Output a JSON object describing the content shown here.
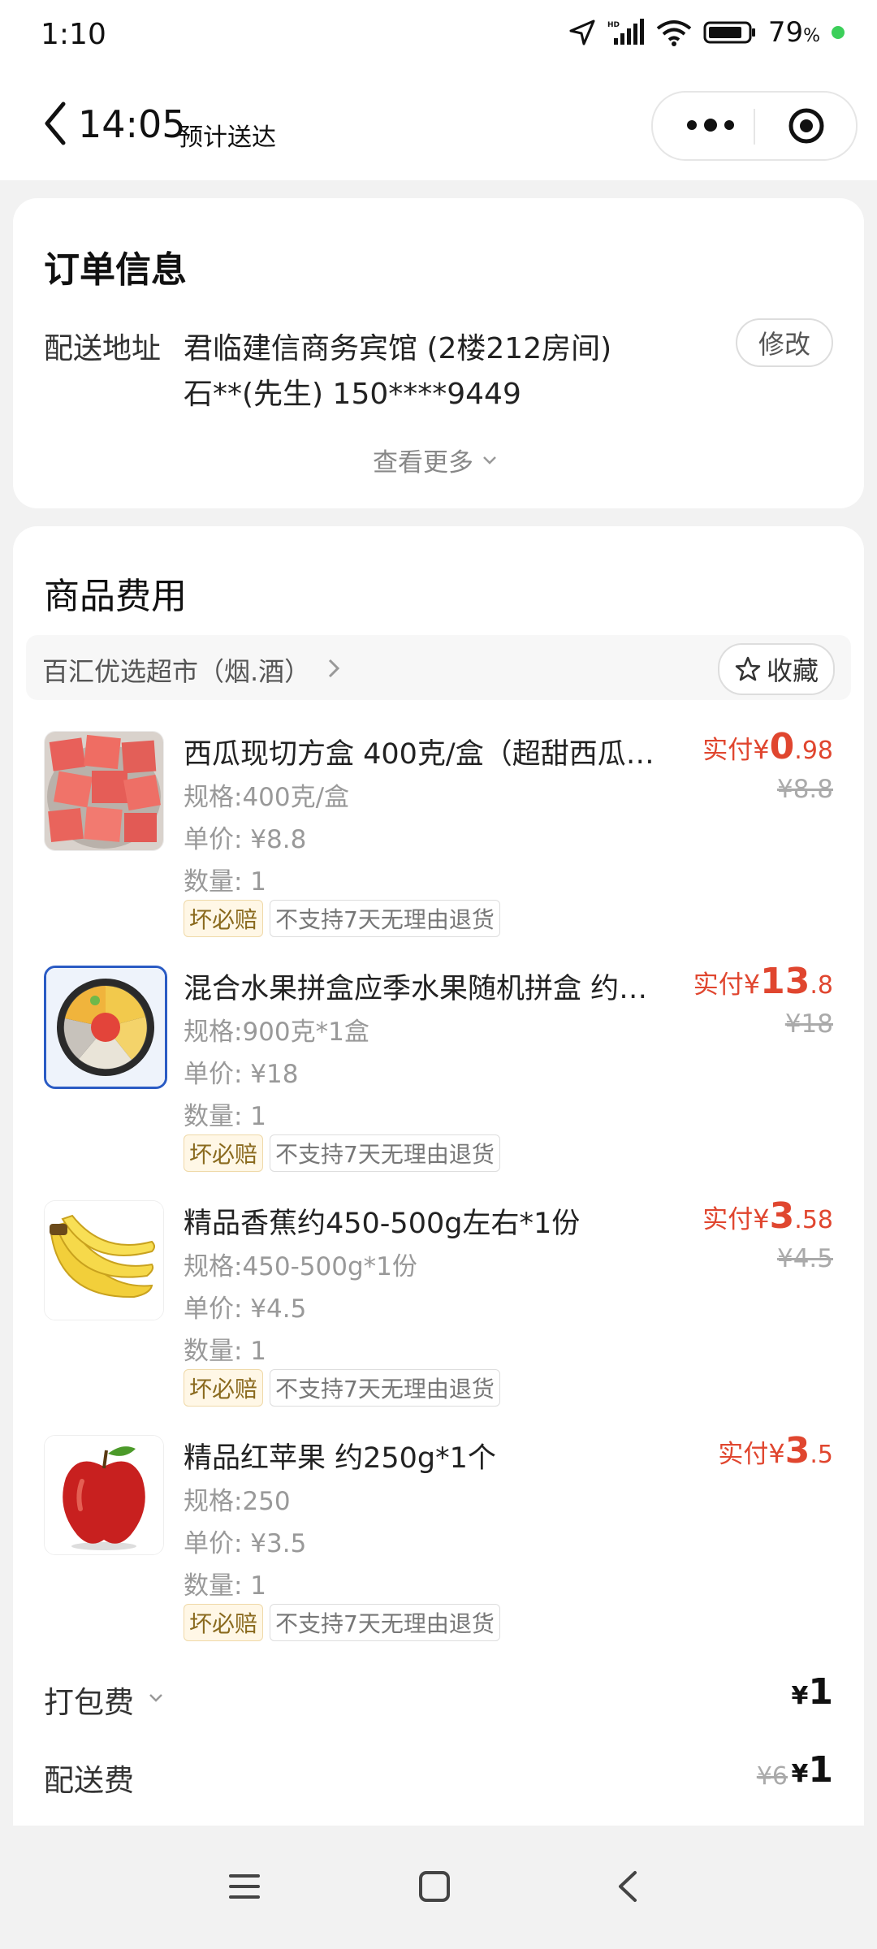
{
  "status": {
    "time": "1:10",
    "battery": "79",
    "battery_unit": "%"
  },
  "nav": {
    "time": "14:05",
    "subtitle": "预计送达"
  },
  "order": {
    "title": "订单信息",
    "address_label": "配送地址",
    "address_line1": "君临建信商务宾馆 (2楼212房间)",
    "address_line2": "石**(先生) 150****9449",
    "edit": "修改",
    "more": "查看更多"
  },
  "goods": {
    "title": "商品费用",
    "shop_name": "百汇优选超市（烟.酒）",
    "favorite": "收藏",
    "items": [
      {
        "name": "西瓜现切方盒 400克/盒（超甜西瓜…",
        "spec": "规格:400克/盒",
        "unit": "单价: ¥8.8",
        "qty": "数量: 1",
        "price_label": "实付",
        "yen": "¥",
        "price_int": "0",
        "price_dec": ".98",
        "orig": "¥8.8"
      },
      {
        "name": "混合水果拼盒应季水果随机拼盒 约…",
        "spec": "规格:900克*1盒",
        "unit": "单价: ¥18",
        "qty": "数量: 1",
        "price_label": "实付",
        "yen": "¥",
        "price_int": "13",
        "price_dec": ".8",
        "orig": "¥18"
      },
      {
        "name": "精品香蕉约450-500g左右*1份",
        "spec": "规格:450-500g*1份",
        "unit": "单价: ¥4.5",
        "qty": "数量: 1",
        "price_label": "实付",
        "yen": "¥",
        "price_int": "3",
        "price_dec": ".58",
        "orig": "¥4.5"
      },
      {
        "name": "精品红苹果 约250g*1个",
        "spec": "规格:250",
        "unit": "单价: ¥3.5",
        "qty": "数量: 1",
        "price_label": "实付",
        "yen": "¥",
        "price_int": "3",
        "price_dec": ".5",
        "orig": ""
      }
    ],
    "tag_guarantee": "坏必赔",
    "tag_return": "不支持7天无理由退货",
    "packing_label": "打包费",
    "packing_yen": "¥",
    "packing_value": "1",
    "delivery_label": "配送费",
    "delivery_orig": "¥6",
    "delivery_yen": "¥",
    "delivery_value": "1"
  }
}
